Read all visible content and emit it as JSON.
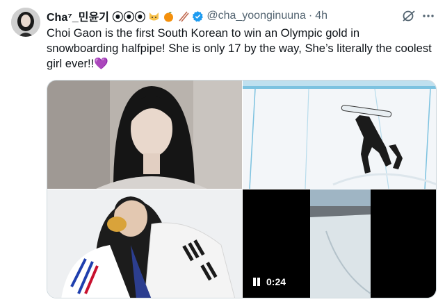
{
  "tweet": {
    "display_name": "Cha⁷_민윤기 ⦿⦿⦿",
    "handle": "@cha_yoonginuuna",
    "separator": "·",
    "time": "4h",
    "text": "Choi Gaon is the first South Korean to win an Olympic gold in\nsnowboarding halfpipe! She is only 17 by the way, She’s literally the coolest\ngirl ever!!💜",
    "verified_color": "#1d9bf0"
  },
  "header_icons": [
    "cat-emoji-icon",
    "orange-emoji-icon",
    "chopsticks-emoji-icon",
    "verified-badge-icon"
  ],
  "actions": {
    "grok_icon": "grok-icon",
    "more_icon": "more-icon"
  },
  "media": {
    "video": {
      "duration": "0:24",
      "state_icon": "pause-icon"
    }
  },
  "colors": {
    "text": "#0f1419",
    "secondary": "#536471",
    "accent": "#1d9bf0"
  }
}
